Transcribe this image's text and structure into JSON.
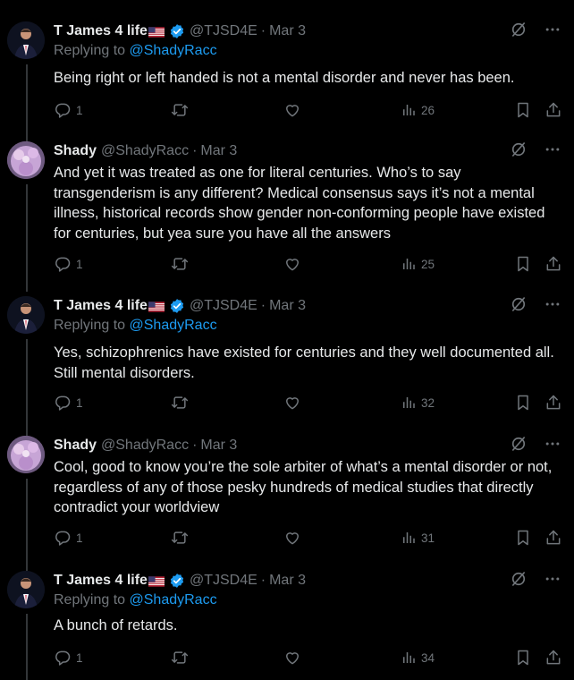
{
  "replying_label": "Replying to",
  "tweets": [
    {
      "name": "T James 4 life",
      "verified": true,
      "handle": "@TJSD4E",
      "date": "Mar 3",
      "replying_to": "@ShadyRacc",
      "text": "Being right or left handed is not a mental disorder and never has been.",
      "replies": "1",
      "views": "26"
    },
    {
      "name": "Shady",
      "verified": false,
      "handle": "@ShadyRacc",
      "date": "Mar 3",
      "replying_to": "",
      "text": "And yet it was treated as one for literal centuries. Who’s to say transgenderism is any different? Medical consensus says it’s not a mental illness, historical records show gender non-conforming people have existed for centuries, but yea sure you have all the answers",
      "replies": "1",
      "views": "25"
    },
    {
      "name": "T James 4 life",
      "verified": true,
      "handle": "@TJSD4E",
      "date": "Mar 3",
      "replying_to": "@ShadyRacc",
      "text": "Yes, schizophrenics have existed for centuries and they well documented all. Still mental disorders.",
      "replies": "1",
      "views": "32"
    },
    {
      "name": "Shady",
      "verified": false,
      "handle": "@ShadyRacc",
      "date": "Mar 3",
      "replying_to": "",
      "text": "Cool, good to know you’re the sole arbiter of what’s a mental disorder or not, regardless of any of those pesky hundreds of medical studies that directly contradict your worldview",
      "replies": "1",
      "views": "31"
    },
    {
      "name": "T James 4 life",
      "verified": true,
      "handle": "@TJSD4E",
      "date": "Mar 3",
      "replying_to": "@ShadyRacc",
      "text": "A bunch of retards.",
      "replies": "1",
      "views": "34"
    }
  ],
  "colors": {
    "background": "#000000",
    "text": "#e7e9ea",
    "muted": "#71767b",
    "link": "#1d9bf0",
    "verified": "#1d9bf0",
    "thread_line": "#333639"
  },
  "icons": {
    "flag": "us-flag-emoji",
    "verified": "verified-badge-icon",
    "grok": "grok-icon",
    "more": "more-icon",
    "reply": "reply-icon",
    "retweet": "retweet-icon",
    "like": "heart-icon",
    "views": "views-icon",
    "bookmark": "bookmark-icon",
    "share": "share-icon"
  }
}
